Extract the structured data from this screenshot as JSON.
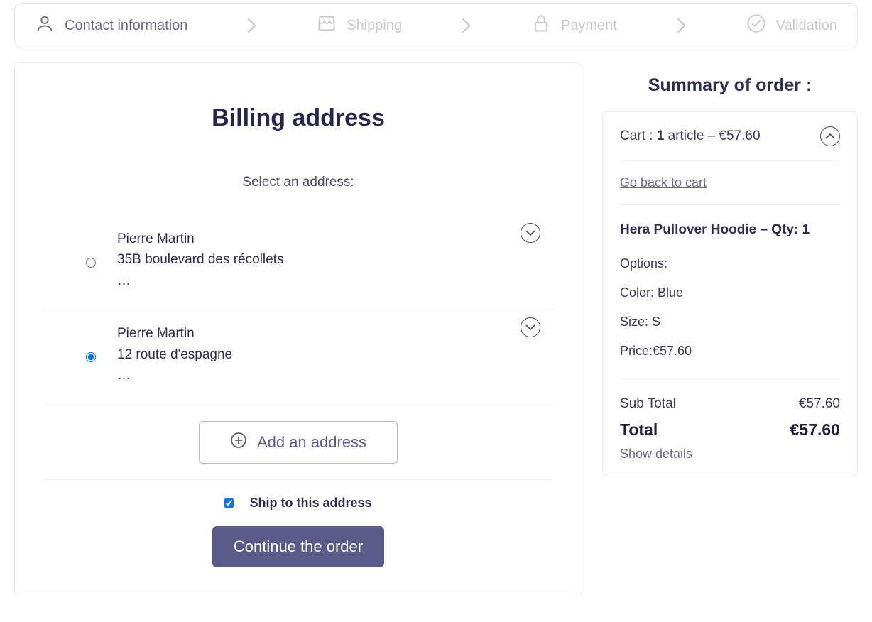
{
  "progress": {
    "steps": [
      {
        "label": "Contact information",
        "icon": "user-icon",
        "active": true
      },
      {
        "label": "Shipping",
        "icon": "shop-icon",
        "active": false
      },
      {
        "label": "Payment",
        "icon": "lock-icon",
        "active": false
      },
      {
        "label": "Validation",
        "icon": "check-circle-icon",
        "active": false
      }
    ]
  },
  "billing": {
    "title": "Billing address",
    "select_label": "Select an address:",
    "addresses": [
      {
        "name": "Pierre Martin",
        "line1": "35B boulevard des récollets",
        "more": "…",
        "selected": false
      },
      {
        "name": "Pierre Martin",
        "line1": "12 route d'espagne",
        "more": "…",
        "selected": true
      }
    ],
    "add_label": "Add an address",
    "ship_to_label": "Ship to this address",
    "ship_to_checked": true,
    "continue_label": "Continue the order"
  },
  "summary": {
    "title": "Summary of order :",
    "cart_prefix": "Cart : ",
    "cart_count": "1",
    "cart_suffix": " article – €57.60",
    "back_link": "Go back to cart",
    "item": {
      "name": "Hera Pullover Hoodie – Qty: 1",
      "options_label": "Options:",
      "color": "Color: Blue",
      "size": "Size: S",
      "price": "Price:€57.60"
    },
    "subtotal_label": "Sub Total",
    "subtotal_value": "€57.60",
    "total_label": "Total",
    "total_value": "€57.60",
    "details_link": "Show details"
  }
}
